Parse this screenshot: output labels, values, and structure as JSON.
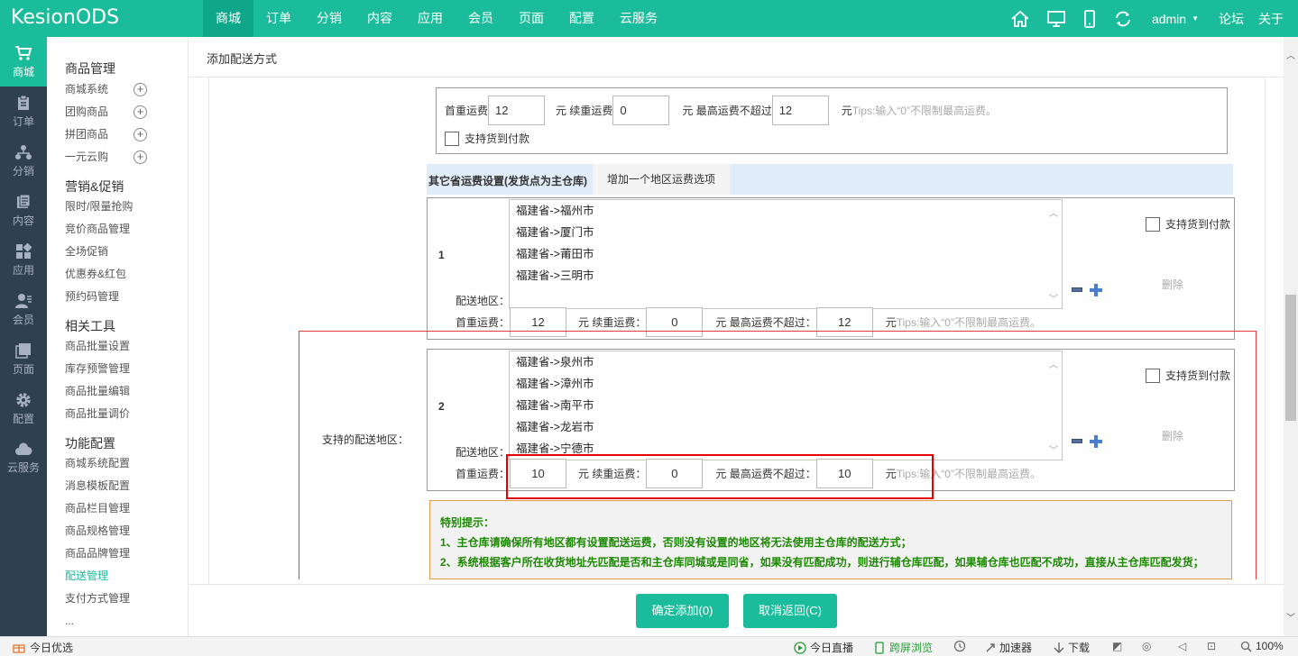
{
  "app": {
    "logo": "KesionODS"
  },
  "topnav": {
    "items": [
      "商城",
      "订单",
      "分销",
      "内容",
      "应用",
      "会员",
      "页面",
      "配置",
      "云服务"
    ],
    "active": "商城"
  },
  "topright": {
    "user": "admin",
    "forum": "论坛",
    "about": "关于"
  },
  "leftbar": {
    "items": [
      {
        "label": "商城",
        "icon": "cart-icon"
      },
      {
        "label": "订单",
        "icon": "clipboard-icon"
      },
      {
        "label": "分销",
        "icon": "network-icon"
      },
      {
        "label": "内容",
        "icon": "document-icon"
      },
      {
        "label": "应用",
        "icon": "apps-icon"
      },
      {
        "label": "会员",
        "icon": "user-icon"
      },
      {
        "label": "页面",
        "icon": "pages-icon"
      },
      {
        "label": "配置",
        "icon": "gear-icon"
      },
      {
        "label": "云服务",
        "icon": "cloud-icon"
      }
    ]
  },
  "submenu": {
    "groups": [
      {
        "title": "商品管理",
        "items": [
          "商城系统",
          "团购商品",
          "拼团商品",
          "一元云购"
        ]
      },
      {
        "title": "营销&促销",
        "items": [
          "限时/限量抢购",
          "竞价商品管理",
          "全场促销",
          "优惠券&红包",
          "预约码管理"
        ]
      },
      {
        "title": "相关工具",
        "items": [
          "商品批量设置",
          "库存预警管理",
          "商品批量编辑",
          "商品批量调价"
        ]
      },
      {
        "title": "功能配置",
        "items": [
          "商城系统配置",
          "消息模板配置",
          "商品栏目管理",
          "商品规格管理",
          "商品品牌管理",
          "配送管理",
          "支付方式管理",
          "..."
        ]
      }
    ],
    "active_item": "配送管理"
  },
  "page": {
    "title": "添加配送方式"
  },
  "main_fee": {
    "first_label": "首重运费",
    "first_value": "12",
    "cont_label": "元 续重运费",
    "cont_value": "0",
    "max_label": "元 最高运费不超过",
    "max_value": "12",
    "unit": "元",
    "tips": "Tips:输入“0”不限制最高运费。",
    "cod_label": "支持货到付款"
  },
  "other_section": {
    "header": "其它省运费设置(发货点为主仓库)",
    "add_tab": "增加一个地区运费选项",
    "field_label": "支持的配送地区：",
    "region_label": "配送地区：",
    "first_label": "首重运费：",
    "cont_label": "元 续重运费：",
    "max_label": "元 最高运费不超过：",
    "unit": "元",
    "tips": "Tips:输入“0”不限制最高运费。",
    "cod_label": "支持货到付款",
    "delete_label": "删除",
    "rows": [
      {
        "index": "1",
        "regions": [
          "福建省->福州市",
          "福建省->厦门市",
          "福建省->莆田市",
          "福建省->三明市"
        ],
        "first": "12",
        "cont": "0",
        "max": "12"
      },
      {
        "index": "2",
        "regions": [
          "福建省->泉州市",
          "福建省->漳州市",
          "福建省->南平市",
          "福建省->龙岩市",
          "福建省->宁德市"
        ],
        "first": "10",
        "cont": "0",
        "max": "10"
      }
    ]
  },
  "notice": {
    "title": "特别提示：",
    "line1": "1、主仓库请确保所有地区都有设置配送运费，否则没有设置的地区将无法使用主仓库的配送方式；",
    "line2": "2、系统根据客户所在收货地址先匹配是否和主仓库同城或是同省，如果没有匹配成功，则进行辅仓库匹配，如果辅仓库也匹配不成功，直接从主仓库匹配发货；"
  },
  "buttons": {
    "confirm": "确定添加(0)",
    "cancel": "取消返回(C)"
  },
  "statusbar": {
    "left": "今日优选",
    "live": "今日直播",
    "cross": "跨屏浏览",
    "accelerator": "加速器",
    "download": "下载",
    "zoom": "100%"
  },
  "colors": {
    "primary": "#1abc9c",
    "sidebar": "#2f4050",
    "notice_text": "#1b8a00"
  }
}
